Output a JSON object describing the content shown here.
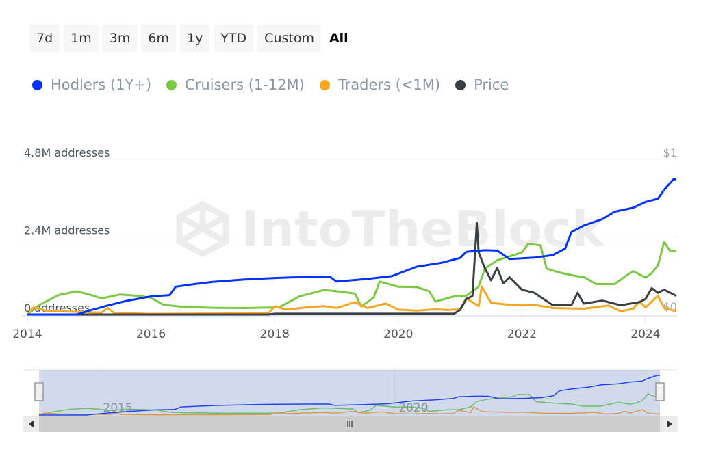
{
  "range_selector": {
    "buttons": [
      "7d",
      "1m",
      "3m",
      "6m",
      "1y",
      "YTD",
      "Custom",
      "All"
    ],
    "active": "All"
  },
  "watermark": "IntoTheBlock",
  "colors": {
    "hodlers": "#0033ff",
    "cruisers": "#7ac943",
    "traders": "#f5a623",
    "price": "#3a3f44"
  },
  "chart_data": {
    "type": "line",
    "title": "",
    "xlabel": "",
    "ylabel": "addresses",
    "xlim": [
      2014.0,
      2024.5
    ],
    "ylim": [
      0,
      4800000
    ],
    "y2lim": [
      0,
      1
    ],
    "grid": true,
    "legend_position": "top-left",
    "x_ticks": [
      "2014",
      "2016",
      "2018",
      "2020",
      "2022",
      "2024"
    ],
    "y_ticks": [
      "0 addresses",
      "2.4M addresses",
      "4.8M addresses"
    ],
    "y2_ticks": [
      "$0",
      "$1"
    ],
    "series": [
      {
        "name": "Hodlers (1Y+)",
        "key": "hodlers",
        "axis": "left",
        "points": [
          [
            2014.0,
            0
          ],
          [
            2014.8,
            0
          ],
          [
            2015.0,
            120000
          ],
          [
            2015.3,
            280000
          ],
          [
            2015.6,
            420000
          ],
          [
            2016.0,
            560000
          ],
          [
            2016.3,
            600000
          ],
          [
            2016.4,
            860000
          ],
          [
            2016.7,
            940000
          ],
          [
            2017.0,
            1010000
          ],
          [
            2017.5,
            1080000
          ],
          [
            2018.0,
            1130000
          ],
          [
            2018.3,
            1150000
          ],
          [
            2018.9,
            1160000
          ],
          [
            2019.0,
            1020000
          ],
          [
            2019.5,
            1100000
          ],
          [
            2019.9,
            1190000
          ],
          [
            2020.3,
            1480000
          ],
          [
            2020.7,
            1600000
          ],
          [
            2021.0,
            1750000
          ],
          [
            2021.1,
            1940000
          ],
          [
            2021.4,
            1990000
          ],
          [
            2021.6,
            1980000
          ],
          [
            2021.8,
            1720000
          ],
          [
            2022.2,
            1760000
          ],
          [
            2022.5,
            1840000
          ],
          [
            2022.7,
            2040000
          ],
          [
            2022.8,
            2550000
          ],
          [
            2023.0,
            2750000
          ],
          [
            2023.3,
            2950000
          ],
          [
            2023.5,
            3180000
          ],
          [
            2023.8,
            3300000
          ],
          [
            2024.0,
            3480000
          ],
          [
            2024.2,
            3580000
          ],
          [
            2024.3,
            3860000
          ],
          [
            2024.45,
            4180000
          ],
          [
            2024.5,
            4180000
          ]
        ]
      },
      {
        "name": "Cruisers (1-12M)",
        "key": "cruisers",
        "axis": "left",
        "points": [
          [
            2014.0,
            0
          ],
          [
            2014.2,
            300000
          ],
          [
            2014.5,
            600000
          ],
          [
            2014.8,
            720000
          ],
          [
            2015.0,
            620000
          ],
          [
            2015.2,
            500000
          ],
          [
            2015.5,
            620000
          ],
          [
            2015.8,
            580000
          ],
          [
            2016.0,
            520000
          ],
          [
            2016.2,
            300000
          ],
          [
            2016.5,
            240000
          ],
          [
            2017.0,
            210000
          ],
          [
            2017.5,
            200000
          ],
          [
            2018.0,
            220000
          ],
          [
            2018.1,
            250000
          ],
          [
            2018.4,
            560000
          ],
          [
            2018.8,
            760000
          ],
          [
            2019.0,
            720000
          ],
          [
            2019.3,
            650000
          ],
          [
            2019.4,
            250000
          ],
          [
            2019.6,
            520000
          ],
          [
            2019.7,
            1020000
          ],
          [
            2020.0,
            860000
          ],
          [
            2020.3,
            850000
          ],
          [
            2020.5,
            720000
          ],
          [
            2020.6,
            400000
          ],
          [
            2020.9,
            560000
          ],
          [
            2021.1,
            580000
          ],
          [
            2021.3,
            860000
          ],
          [
            2021.4,
            1420000
          ],
          [
            2021.6,
            1680000
          ],
          [
            2021.8,
            1800000
          ],
          [
            2022.0,
            1920000
          ],
          [
            2022.1,
            2180000
          ],
          [
            2022.3,
            2140000
          ],
          [
            2022.4,
            1420000
          ],
          [
            2022.6,
            1300000
          ],
          [
            2022.9,
            1180000
          ],
          [
            2023.0,
            1160000
          ],
          [
            2023.2,
            940000
          ],
          [
            2023.5,
            940000
          ],
          [
            2023.7,
            1220000
          ],
          [
            2023.8,
            1340000
          ],
          [
            2024.0,
            1140000
          ],
          [
            2024.1,
            1280000
          ],
          [
            2024.2,
            1520000
          ],
          [
            2024.3,
            2240000
          ],
          [
            2024.4,
            1960000
          ],
          [
            2024.5,
            1960000
          ]
        ]
      },
      {
        "name": "Traders (<1M)",
        "key": "traders",
        "axis": "left",
        "points": [
          [
            2014.0,
            0
          ],
          [
            2014.1,
            220000
          ],
          [
            2014.3,
            120000
          ],
          [
            2014.8,
            80000
          ],
          [
            2015.2,
            60000
          ],
          [
            2015.3,
            200000
          ],
          [
            2015.4,
            50000
          ],
          [
            2016.0,
            20000
          ],
          [
            2017.0,
            30000
          ],
          [
            2017.9,
            40000
          ],
          [
            2018.0,
            250000
          ],
          [
            2018.2,
            150000
          ],
          [
            2018.5,
            220000
          ],
          [
            2018.8,
            260000
          ],
          [
            2019.0,
            200000
          ],
          [
            2019.3,
            380000
          ],
          [
            2019.5,
            200000
          ],
          [
            2019.8,
            340000
          ],
          [
            2020.0,
            150000
          ],
          [
            2020.3,
            120000
          ],
          [
            2020.6,
            160000
          ],
          [
            2020.8,
            140000
          ],
          [
            2021.0,
            160000
          ],
          [
            2021.1,
            500000
          ],
          [
            2021.2,
            380000
          ],
          [
            2021.3,
            260000
          ],
          [
            2021.35,
            860000
          ],
          [
            2021.5,
            360000
          ],
          [
            2021.8,
            300000
          ],
          [
            2022.0,
            280000
          ],
          [
            2022.2,
            300000
          ],
          [
            2022.5,
            200000
          ],
          [
            2023.0,
            180000
          ],
          [
            2023.4,
            280000
          ],
          [
            2023.6,
            100000
          ],
          [
            2023.8,
            180000
          ],
          [
            2023.9,
            400000
          ],
          [
            2024.0,
            220000
          ],
          [
            2024.2,
            580000
          ],
          [
            2024.3,
            200000
          ],
          [
            2024.5,
            100000
          ]
        ]
      },
      {
        "name": "Price",
        "key": "price",
        "axis": "right",
        "points": [
          [
            2014.0,
            0.0
          ],
          [
            2017.9,
            0.0
          ],
          [
            2018.0,
            0.005
          ],
          [
            2020.9,
            0.005
          ],
          [
            2021.0,
            0.03
          ],
          [
            2021.1,
            0.1
          ],
          [
            2021.2,
            0.12
          ],
          [
            2021.27,
            0.59
          ],
          [
            2021.3,
            0.4
          ],
          [
            2021.4,
            0.3
          ],
          [
            2021.5,
            0.22
          ],
          [
            2021.6,
            0.3
          ],
          [
            2021.7,
            0.2
          ],
          [
            2021.8,
            0.24
          ],
          [
            2022.0,
            0.16
          ],
          [
            2022.2,
            0.14
          ],
          [
            2022.5,
            0.06
          ],
          [
            2022.8,
            0.06
          ],
          [
            2022.9,
            0.14
          ],
          [
            2023.0,
            0.07
          ],
          [
            2023.3,
            0.09
          ],
          [
            2023.6,
            0.06
          ],
          [
            2023.9,
            0.08
          ],
          [
            2024.0,
            0.1
          ],
          [
            2024.1,
            0.17
          ],
          [
            2024.2,
            0.14
          ],
          [
            2024.3,
            0.16
          ],
          [
            2024.5,
            0.12
          ]
        ]
      }
    ]
  },
  "navigator": {
    "x_labels": [
      "2015",
      "2020"
    ],
    "scrollbar_grip": "III",
    "left_handle": "II",
    "right_handle": "II"
  }
}
